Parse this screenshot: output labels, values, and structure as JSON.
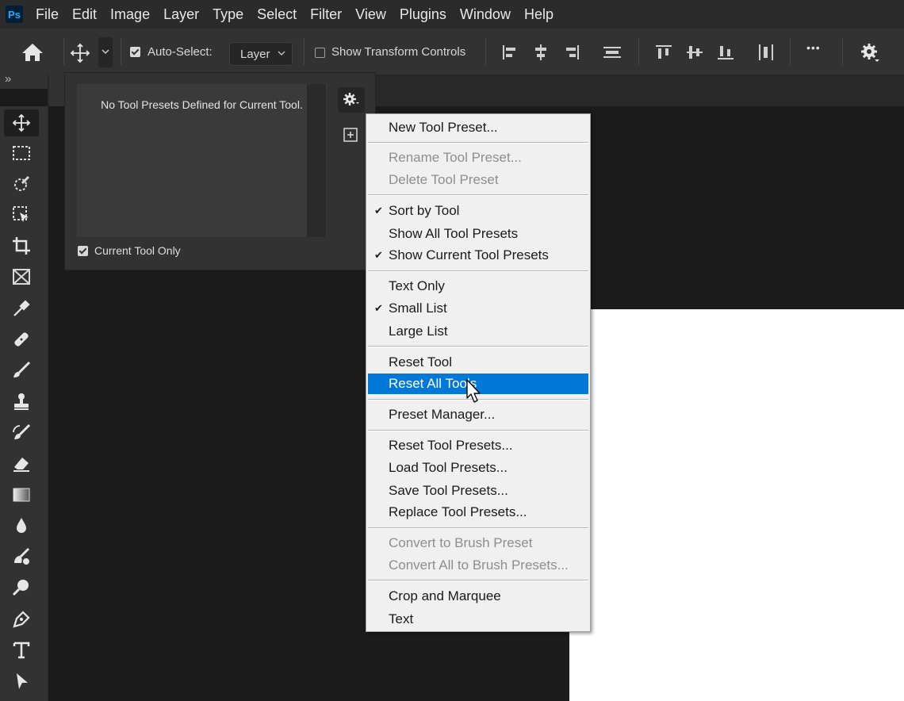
{
  "app": {
    "logo": "Ps"
  },
  "menubar": {
    "items": [
      "File",
      "Edit",
      "Image",
      "Layer",
      "Type",
      "Select",
      "Filter",
      "View",
      "Plugins",
      "Window",
      "Help"
    ]
  },
  "optionsbar": {
    "auto_select_label": "Auto-Select:",
    "auto_select_checked": true,
    "layer_value": "Layer",
    "show_transform_label": "Show Transform Controls",
    "show_transform_checked": false,
    "more_glyph": "•••"
  },
  "toolbar": {
    "collapse_glyph": "»"
  },
  "presets_panel": {
    "empty_message": "No Tool Presets Defined for Current Tool.",
    "current_tool_only_label": "Current Tool Only",
    "current_tool_only_checked": true
  },
  "context_menu": {
    "items": [
      {
        "label": "New Tool Preset...",
        "enabled": true,
        "checked": false
      },
      {
        "label": "Rename Tool Preset...",
        "enabled": false,
        "checked": false
      },
      {
        "label": "Delete Tool Preset",
        "enabled": false,
        "checked": false
      },
      {
        "label": "Sort by Tool",
        "enabled": true,
        "checked": true
      },
      {
        "label": "Show All Tool Presets",
        "enabled": true,
        "checked": false
      },
      {
        "label": "Show Current Tool Presets",
        "enabled": true,
        "checked": true
      },
      {
        "label": "Text Only",
        "enabled": true,
        "checked": false
      },
      {
        "label": "Small List",
        "enabled": true,
        "checked": true
      },
      {
        "label": "Large List",
        "enabled": true,
        "checked": false
      },
      {
        "label": "Reset Tool",
        "enabled": true,
        "checked": false
      },
      {
        "label": "Reset All Tools",
        "enabled": true,
        "checked": false,
        "highlighted": true
      },
      {
        "label": "Preset Manager...",
        "enabled": true,
        "checked": false
      },
      {
        "label": "Reset Tool Presets...",
        "enabled": true,
        "checked": false
      },
      {
        "label": "Load Tool Presets...",
        "enabled": true,
        "checked": false
      },
      {
        "label": "Save Tool Presets...",
        "enabled": true,
        "checked": false
      },
      {
        "label": "Replace Tool Presets...",
        "enabled": true,
        "checked": false
      },
      {
        "label": "Convert to Brush Preset",
        "enabled": false,
        "checked": false
      },
      {
        "label": "Convert All to Brush Presets...",
        "enabled": false,
        "checked": false
      },
      {
        "label": "Crop and Marquee",
        "enabled": true,
        "checked": false
      },
      {
        "label": "Text",
        "enabled": true,
        "checked": false
      }
    ],
    "check_glyph": "✔",
    "highlight_color": "#0078d7"
  }
}
